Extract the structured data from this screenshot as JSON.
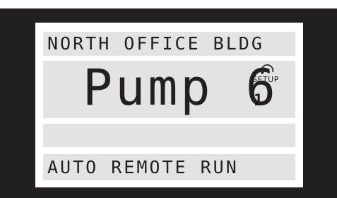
{
  "display": {
    "line1": "NORTH OFFICE BLDG",
    "line2_main": "Pump 6",
    "setup_label": "SETUP",
    "setup_number": "1",
    "line3": "",
    "line4": "AUTO REMOTE RUN"
  },
  "colors": {
    "bezel": "#231f20",
    "screen": "#ffffff",
    "row_background": "#e3e3e3",
    "text": "#231f20"
  },
  "icons": {
    "setup": "undo-arrow-icon"
  }
}
